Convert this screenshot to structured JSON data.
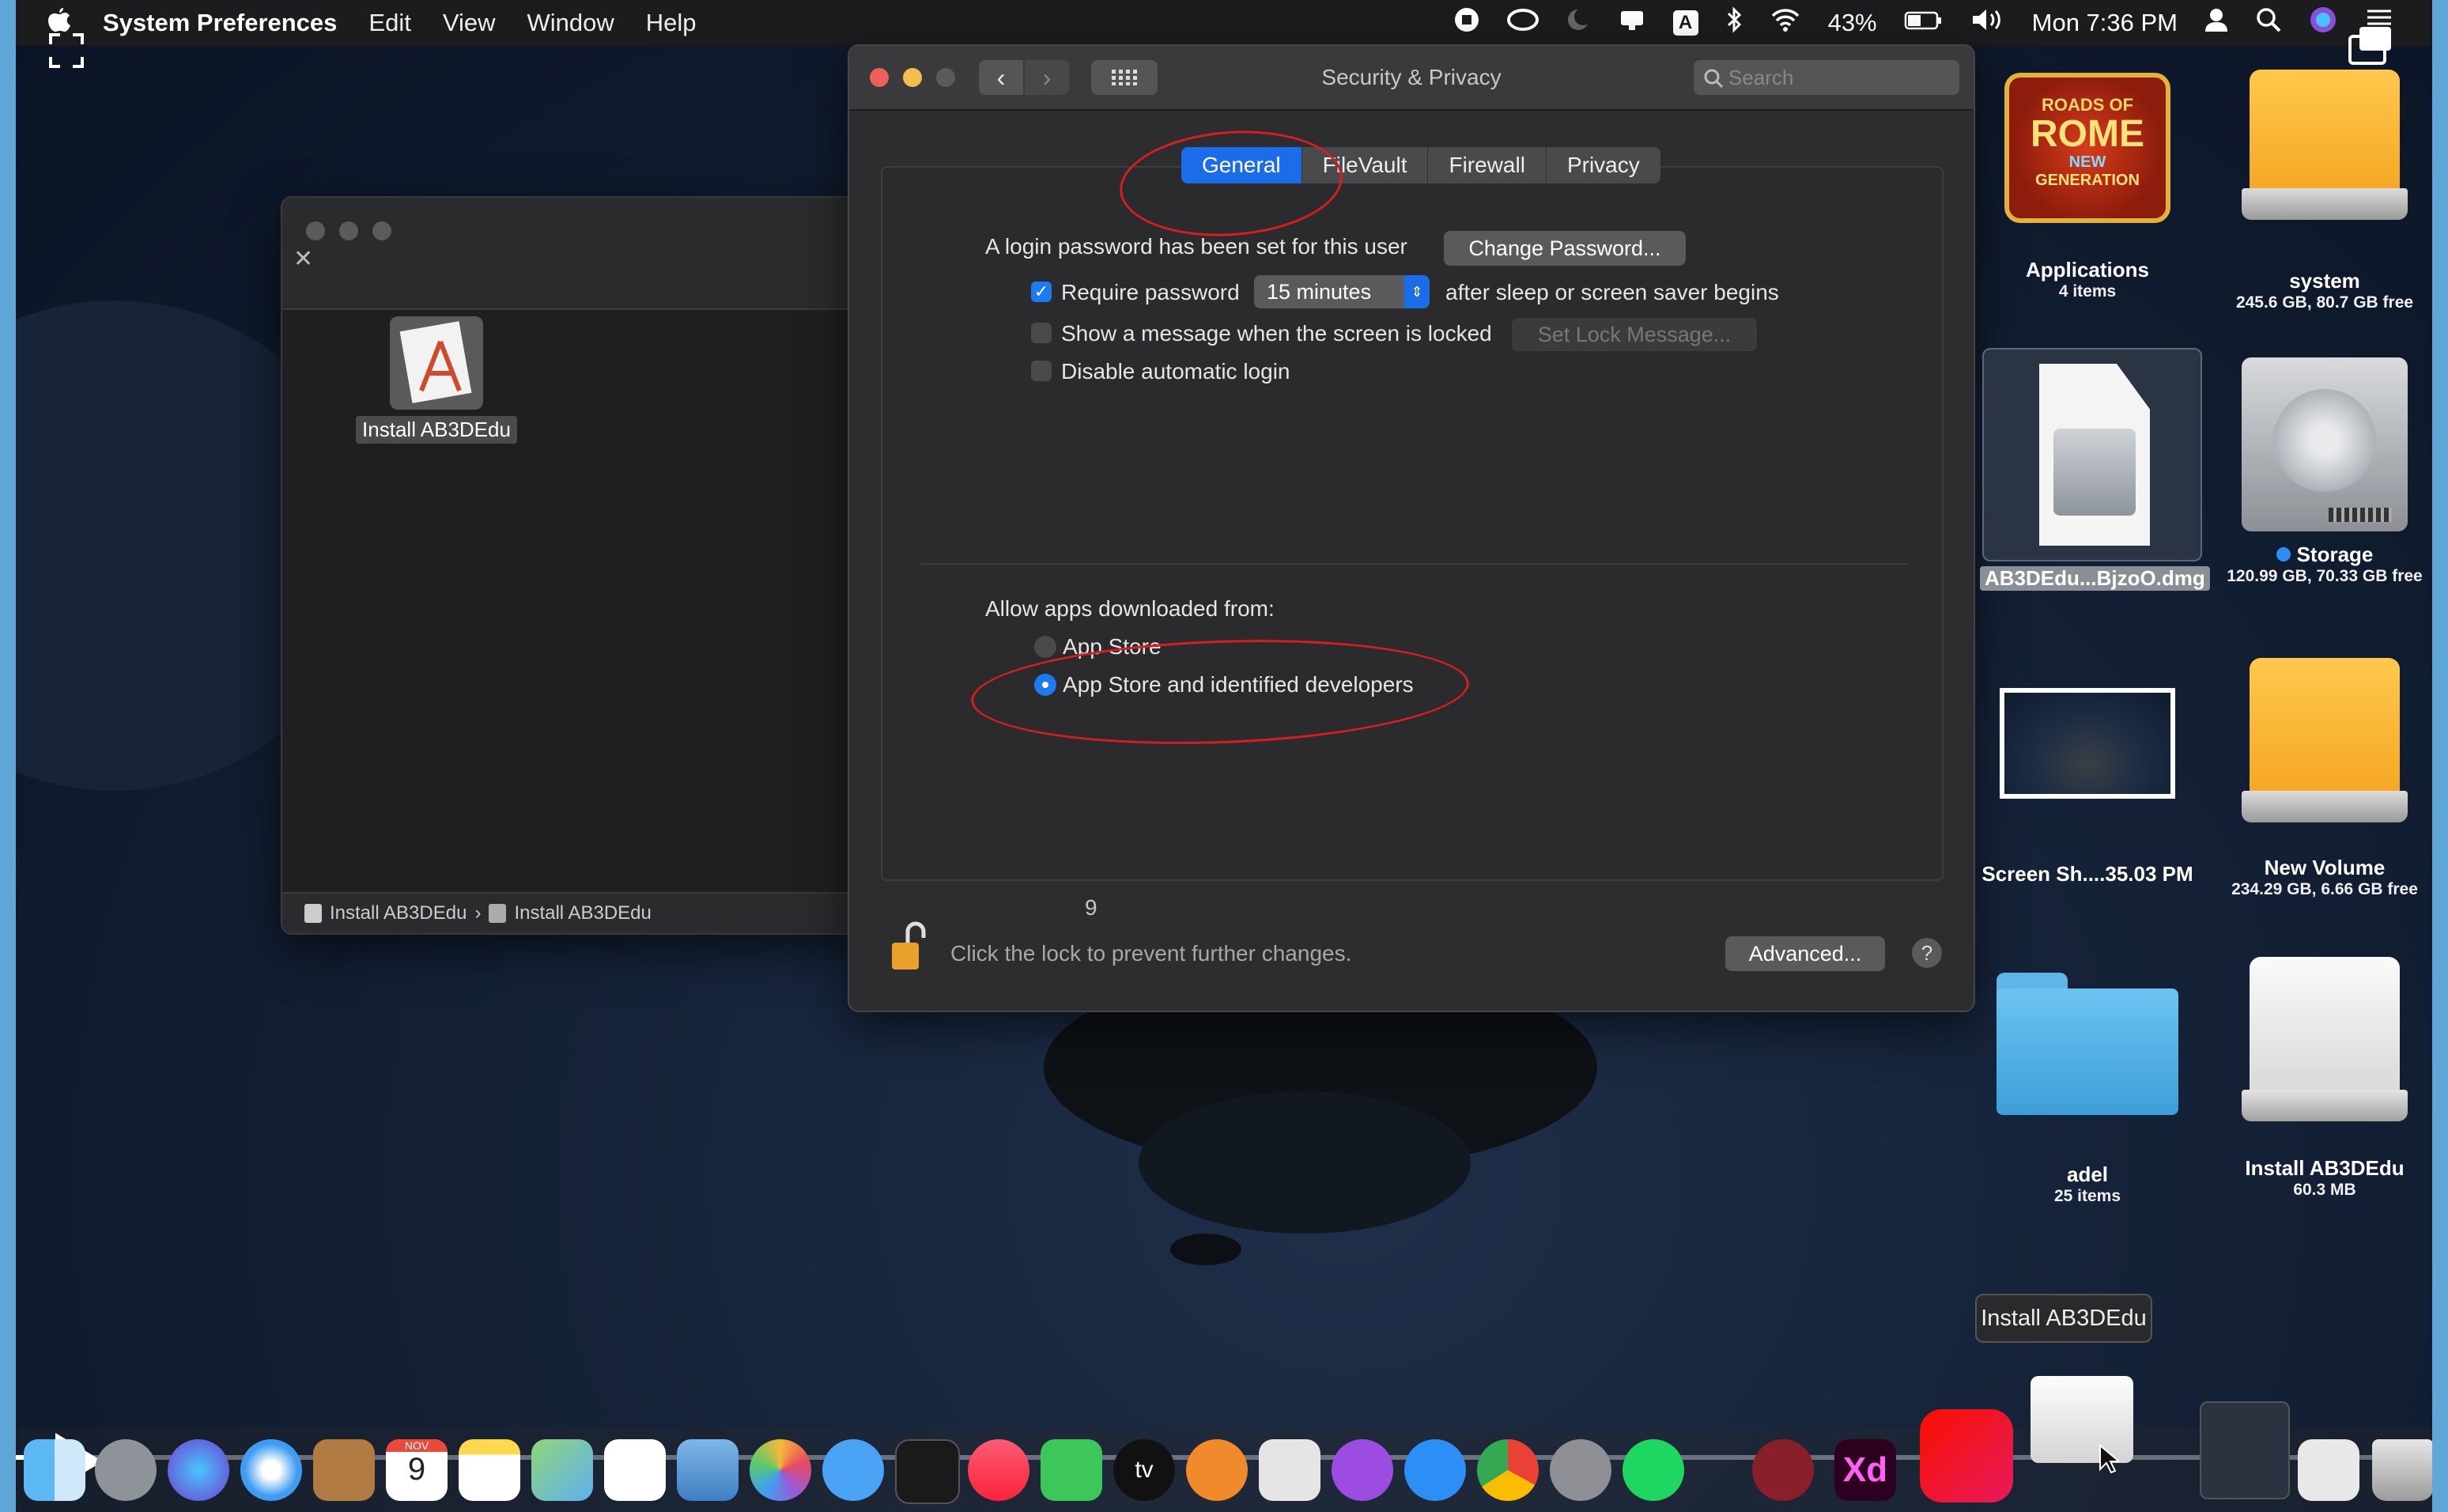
{
  "menubar": {
    "app_name": "System Preferences",
    "menus": [
      "Edit",
      "View",
      "Window",
      "Help"
    ],
    "battery": "43%",
    "clock": "Mon 7:36 PM",
    "status_a": "A"
  },
  "finder": {
    "item_label": "Install AB3DEdu",
    "path": [
      "Install AB3DEdu",
      "›",
      "Install AB3DEdu"
    ]
  },
  "prefs": {
    "title": "Security & Privacy",
    "search_placeholder": "Search",
    "tabs": [
      "General",
      "FileVault",
      "Firewall",
      "Privacy"
    ],
    "active_tab": "General",
    "login_text": "A login password has been set for this user",
    "change_password": "Change Password...",
    "require_password_label": "Require password",
    "require_password_checked": true,
    "require_interval": "15 minutes",
    "after_sleep_text": "after sleep or screen saver begins",
    "show_message_label": "Show a message when the screen is locked",
    "set_lock_message": "Set Lock Message...",
    "disable_login_label": "Disable automatic login",
    "allow_apps_label": "Allow apps downloaded from:",
    "option_app_store": "App Store",
    "option_identified": "App Store and identified developers",
    "selected_option": "App Store and identified developers",
    "stray_digit": "9",
    "lock_text": "Click the lock to prevent further changes.",
    "advanced": "Advanced...",
    "help": "?"
  },
  "desktop": {
    "icons": [
      {
        "label": "Applications",
        "sub": "4 items"
      },
      {
        "label": "system",
        "sub": "245.6 GB, 80.7 GB free"
      },
      {
        "label": "AB3DEdu...BjzoO.dmg",
        "sub": ""
      },
      {
        "label": "Storage",
        "sub": "120.99 GB, 70.33 GB free"
      },
      {
        "label": "Screen Sh....35.03 PM",
        "sub": ""
      },
      {
        "label": "New Volume",
        "sub": "234.29 GB, 6.66 GB free"
      },
      {
        "label": "adel",
        "sub": "25 items"
      },
      {
        "label": "Install AB3DEdu",
        "sub": "60.3 MB"
      }
    ],
    "game_logo_text": [
      "ROADS OF",
      "ROME",
      "NEW",
      "GENERATION"
    ]
  },
  "dock": {
    "tooltip": "Install AB3DEdu",
    "calendar_day": "9",
    "calendar_month": "NOV",
    "tv_label": "tv",
    "xd_label": "Xd",
    "playback_progress": 0.02
  },
  "colors": {
    "accent": "#1b6ce8",
    "annotation": "#d61e1e",
    "frame_border": "#5ea7d8"
  }
}
